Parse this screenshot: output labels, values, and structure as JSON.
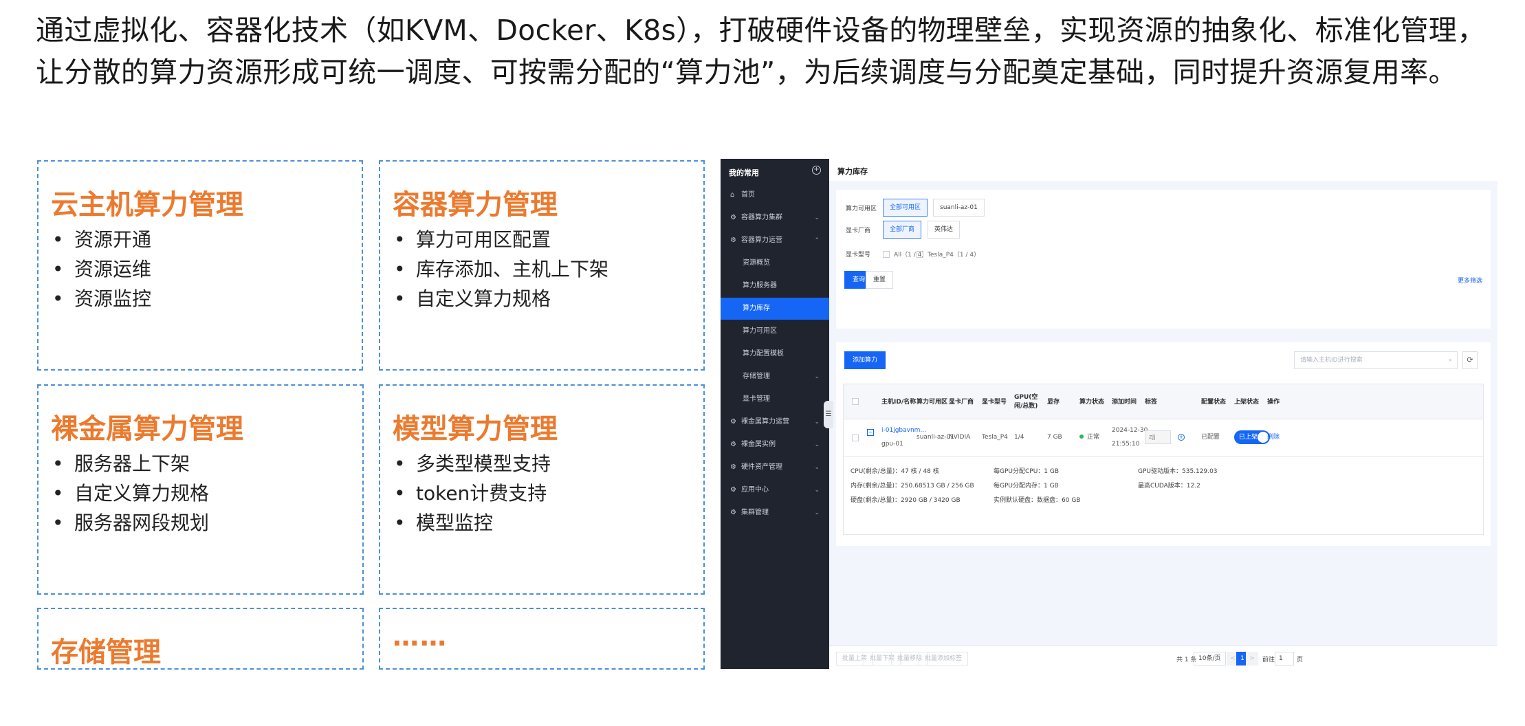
{
  "intro": "通过虚拟化、容器化技术（如KVM、Docker、K8s），打破硬件设备的物理壁垒，实现资源的抽象化、标准化管理，让分散的算力资源形成可统一调度、可按需分配的“算力池”，为后续调度与分配奠定基础，同时提升资源复用率。",
  "colors": {
    "accent": "#ec7a2e",
    "card_border": "#4a90d9",
    "primary": "#1666f5",
    "sidebar_bg": "#20242e"
  },
  "cards": [
    {
      "title": "云主机算力管理",
      "items": [
        "资源开通",
        "资源运维",
        "资源监控"
      ]
    },
    {
      "title": "容器算力管理",
      "items": [
        "算力可用区配置",
        "库存添加、主机上下架",
        "自定义算力规格"
      ]
    },
    {
      "title": "裸金属算力管理",
      "items": [
        "服务器上下架",
        "自定义算力规格",
        "服务器网段规划"
      ]
    },
    {
      "title": "模型算力管理",
      "items": [
        "多类型模型支持",
        "token计费支持",
        "模型监控"
      ]
    },
    {
      "title": "存储管理",
      "items": []
    },
    {
      "title": "……",
      "items": []
    }
  ],
  "bullet": "•",
  "sidebar": {
    "header": "我的常用",
    "plus": "+",
    "items": [
      {
        "label": "首页",
        "icon": "home-icon"
      },
      {
        "label": "容器算力集群",
        "icon": "cluster-icon",
        "chev": "⌄"
      },
      {
        "label": "容器算力运营",
        "icon": "ops-icon",
        "chev": "⌃"
      },
      {
        "label": "资源概览"
      },
      {
        "label": "算力服务器"
      },
      {
        "label": "算力库存"
      },
      {
        "label": "算力可用区"
      },
      {
        "label": "算力配置模板"
      },
      {
        "label": "存储管理",
        "chev": "⌄"
      },
      {
        "label": "显卡管理"
      },
      {
        "label": "裸金属算力运营",
        "icon": "baremetal-icon",
        "chev": "⌄"
      },
      {
        "label": "裸金属实例",
        "icon": "instance-icon",
        "chev": "⌄"
      },
      {
        "label": "硬件资产管理",
        "icon": "hardware-icon",
        "chev": "⌄"
      },
      {
        "label": "应用中心",
        "icon": "app-icon",
        "chev": "⌄"
      },
      {
        "label": "集群管理",
        "icon": "cluster-mgmt-icon",
        "chev": "⌄"
      }
    ]
  },
  "page_title": "算力库存",
  "filters": {
    "zone_label": "算力可用区",
    "zone_options": [
      "全部可用区",
      "suanli-az-01"
    ],
    "vendor_label": "显卡厂商",
    "vendor_options": [
      "全部厂商",
      "英伟达"
    ],
    "model_label": "显卡型号",
    "model_options": [
      "All（1 / 4）",
      "Tesla_P4（1 / 4）"
    ],
    "query": "查询",
    "reset": "重置",
    "more": "更多筛选"
  },
  "list": {
    "add_button": "添加算力",
    "search_placeholder": "请输入主机ID进行搜索",
    "refresh": "⟳",
    "columns": [
      "主机ID/名称",
      "算力可用区",
      "显卡厂商",
      "显卡型号",
      "GPU(空闲/总数)",
      "显存",
      "算力状态",
      "添加时间",
      "标签",
      "配置状态",
      "上架状态",
      "操作"
    ],
    "row": {
      "host_id": "i-01jgbavnm...",
      "host_name": "gpu-01",
      "zone": "suanli-az-01",
      "vendor": "NVIDIA",
      "model": "Tesla_P4",
      "gpu": "1/4",
      "vram": "7 GB",
      "status": "正常",
      "time_date": "2024-12-30",
      "time_clock": "21:55:10",
      "tag": "zjj",
      "config": "已配置",
      "shelf": "已上架",
      "action": "删除"
    },
    "detail": {
      "cpu": "CPU(剩余/总量)：47 核 / 48 核",
      "mem": "内存(剩余/总量)：250.68513 GB / 256 GB",
      "disk": "硬盘(剩余/总量)：2920 GB / 3420 GB",
      "gpu_cpu": "每GPU分配CPU：1 GB",
      "gpu_mem": "每GPU分配内存：1 GB",
      "default_disk": "实例默认硬盘：数据盘：60 GB",
      "driver": "GPU驱动版本：535.129.03",
      "cuda": "最高CUDA版本：12.2"
    }
  },
  "footer": {
    "buttons": [
      "批量上架",
      "批量下架",
      "批量移除",
      "批量添加标签"
    ],
    "total": "共 1 条",
    "page_size": "10条/页",
    "prev": "<",
    "page": "1",
    "next": ">",
    "goto_label": "前往",
    "goto_value": "1",
    "page_unit": "页"
  }
}
